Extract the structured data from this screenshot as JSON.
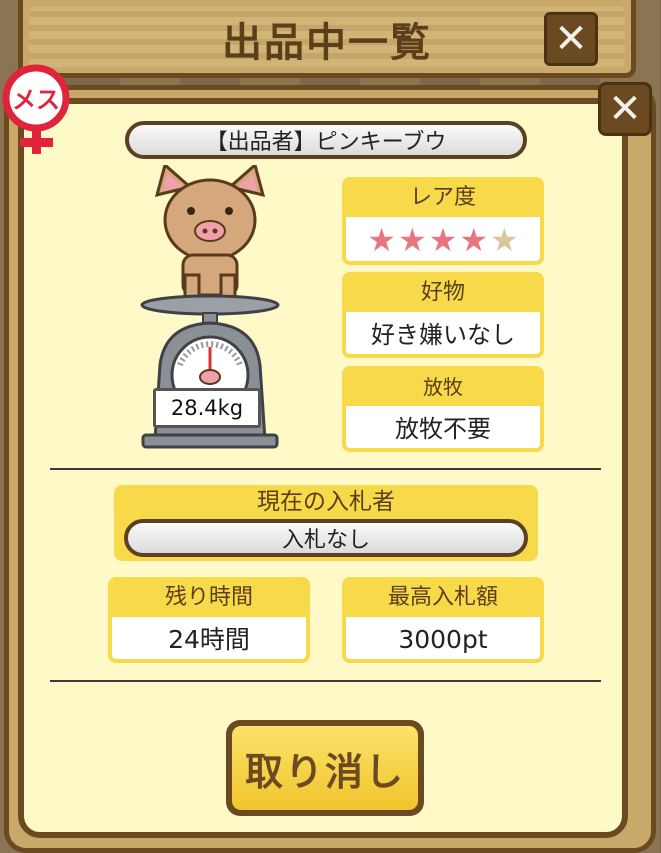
{
  "title": "出品中一覧",
  "close_symbol": "✕",
  "gender_badge": {
    "label": "メス",
    "color": "#e0243c"
  },
  "seller": {
    "text": "【出品者】ピンキーブウ"
  },
  "pig": {
    "weight": "28.4kg"
  },
  "rarity": {
    "label": "レア度",
    "stars_filled": 4,
    "stars_total": 5,
    "filled_color": "#e8767f",
    "empty_color": "#d8c79a"
  },
  "favorite": {
    "label": "好物",
    "value": "好き嫌いなし"
  },
  "grazing": {
    "label": "放牧",
    "value": "放牧不要"
  },
  "current_bidder": {
    "label": "現在の入札者",
    "value": "入札なし"
  },
  "remaining_time": {
    "label": "残り時間",
    "value": "24時間"
  },
  "highest_bid": {
    "label": "最高入札額",
    "value": "3000pt"
  },
  "cancel_button": {
    "label": "取り消し"
  },
  "colors": {
    "card_header": "#f7d94a",
    "panel_bg": "#fff9c8",
    "wood_border": "#6b4a22"
  }
}
